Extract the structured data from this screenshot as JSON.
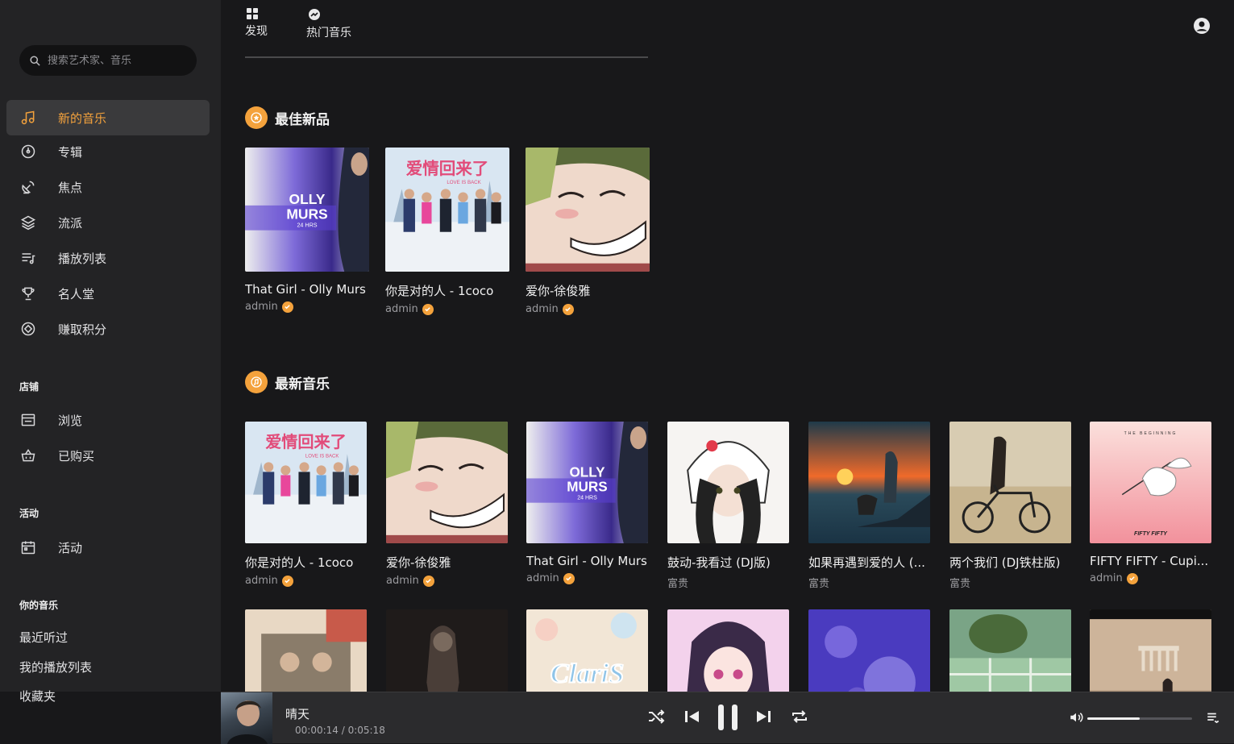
{
  "search": {
    "placeholder": "搜索艺术家、音乐"
  },
  "sidebar": {
    "items": [
      {
        "label": "新的音乐",
        "icon": "music-note-icon"
      },
      {
        "label": "专辑",
        "icon": "disc-icon"
      },
      {
        "label": "焦点",
        "icon": "satellite-dish-icon"
      },
      {
        "label": "流派",
        "icon": "layers-icon"
      },
      {
        "label": "播放列表",
        "icon": "playlist-icon"
      },
      {
        "label": "名人堂",
        "icon": "trophy-icon"
      },
      {
        "label": "赚取积分",
        "icon": "coin-icon"
      }
    ],
    "store_title": "店铺",
    "store_items": [
      {
        "label": "浏览",
        "icon": "store-icon"
      },
      {
        "label": "已购买",
        "icon": "basket-icon"
      }
    ],
    "events_title": "活动",
    "events_items": [
      {
        "label": "活动",
        "icon": "calendar-icon"
      }
    ],
    "yours_title": "你的音乐",
    "yours_links": [
      "最近听过",
      "我的播放列表",
      "收藏夹"
    ]
  },
  "topnav": {
    "tabs": [
      {
        "label": "发现",
        "icon": "grid-icon"
      },
      {
        "label": "热门音乐",
        "icon": "trending-icon"
      }
    ]
  },
  "sections": {
    "featured_title": "最佳新品",
    "latest_title": "最新音乐"
  },
  "featured": [
    {
      "title": "That Girl - Olly Murs",
      "artist": "admin",
      "verified": true,
      "cover": "olly"
    },
    {
      "title": "你是对的人 - 1coco",
      "artist": "admin",
      "verified": true,
      "cover": "love"
    },
    {
      "title": "爱你-徐俊雅",
      "artist": "admin",
      "verified": true,
      "cover": "anime"
    }
  ],
  "latest": [
    {
      "title": "你是对的人 - 1coco",
      "artist": "admin",
      "verified": true,
      "cover": "love"
    },
    {
      "title": "爱你-徐俊雅",
      "artist": "admin",
      "verified": true,
      "cover": "anime"
    },
    {
      "title": "That Girl - Olly Murs",
      "artist": "admin",
      "verified": true,
      "cover": "olly"
    },
    {
      "title": "鼓动-我看过 (DJ版)",
      "artist": "富贵",
      "verified": false,
      "cover": "kitty"
    },
    {
      "title": "如果再遇到爱的人 (...",
      "artist": "富贵",
      "verified": false,
      "cover": "sunset"
    },
    {
      "title": "两个我们 (DJ铁柱版)",
      "artist": "富贵",
      "verified": false,
      "cover": "bike"
    },
    {
      "title": "FIFTY FIFTY - Cupi...",
      "artist": "admin",
      "verified": true,
      "cover": "cupid"
    }
  ],
  "row3": [
    "collage",
    "dark",
    "claris",
    "animegirl",
    "purple",
    "pot",
    "ruins"
  ],
  "cover_text": {
    "olly": [
      "OLLY",
      "MURS",
      "24 HRS"
    ],
    "love": [
      "爱情回来了",
      "LOVE IS BACK"
    ],
    "cupid": [
      "THE BEGINNING",
      "FIFTY FIFTY"
    ],
    "claris": [
      "ClariS"
    ]
  },
  "player": {
    "song": "晴天",
    "time": "00:00:14 / 0:05:18",
    "volume": 0.5
  },
  "colors": {
    "accent": "#f4a23c",
    "sidebar_bg": "#232325",
    "main_bg": "#18181a"
  }
}
